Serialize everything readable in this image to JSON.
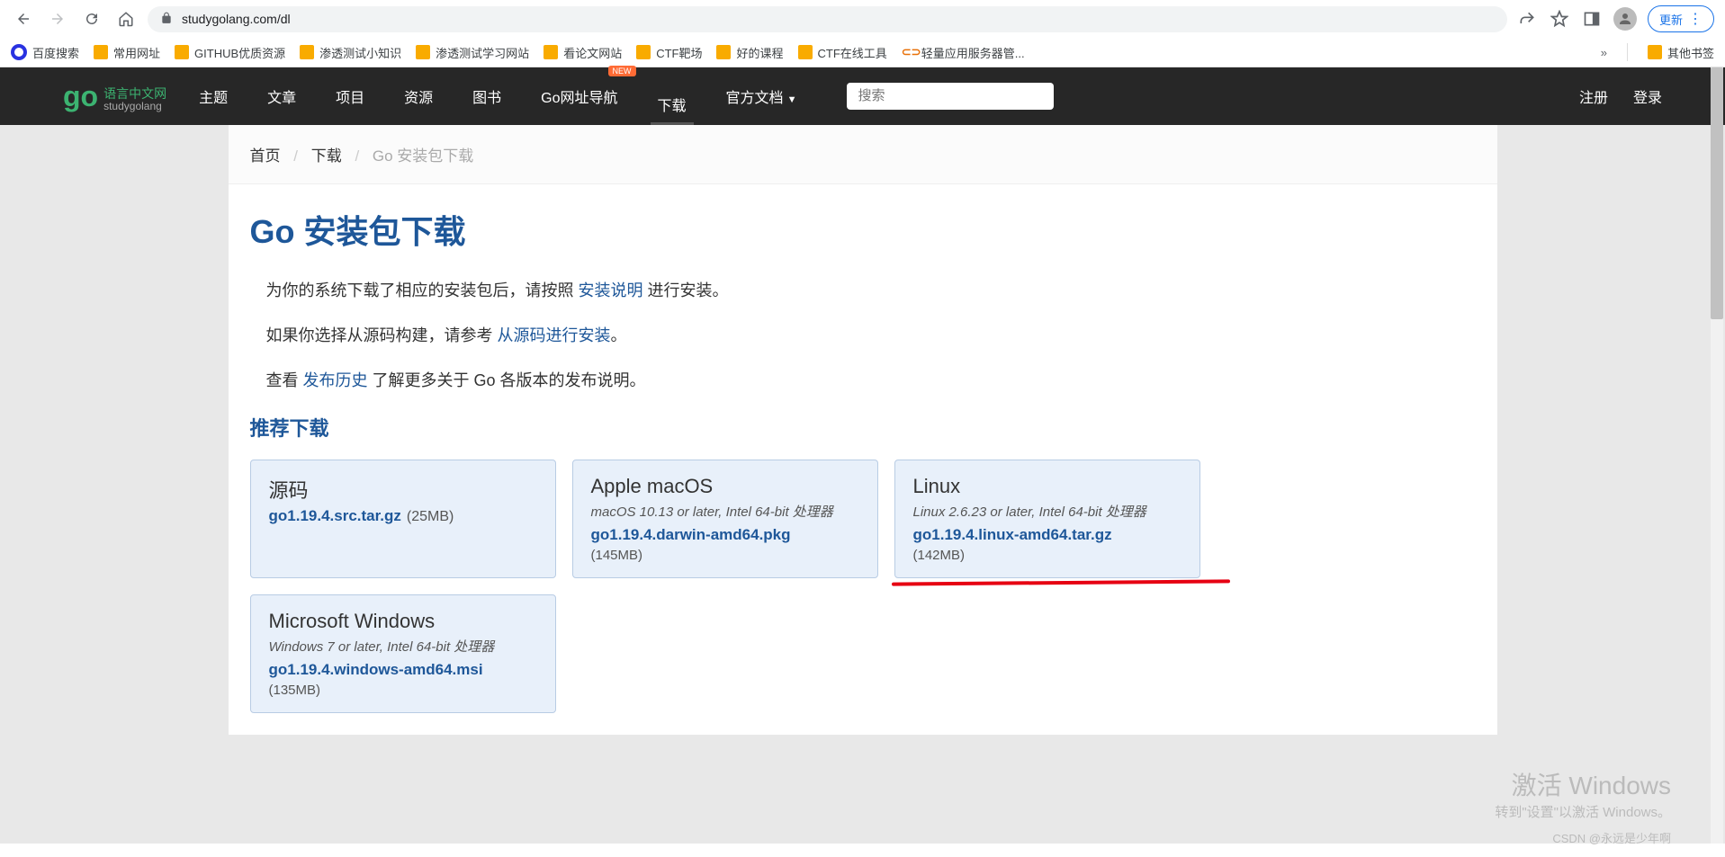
{
  "browser": {
    "url_display": "studygolang.com/dl",
    "update_label": "更新",
    "bookmarks": [
      {
        "icon": "baidu",
        "label": "百度搜索"
      },
      {
        "icon": "folder",
        "label": "常用网址"
      },
      {
        "icon": "folder",
        "label": "GITHUB优质资源"
      },
      {
        "icon": "folder",
        "label": "渗透测试小知识"
      },
      {
        "icon": "folder",
        "label": "渗透测试学习网站"
      },
      {
        "icon": "folder",
        "label": "看论文网站"
      },
      {
        "icon": "folder",
        "label": "CTF靶场"
      },
      {
        "icon": "folder",
        "label": "好的课程"
      },
      {
        "icon": "folder",
        "label": "CTF在线工具"
      },
      {
        "icon": "link",
        "label": "轻量应用服务器管..."
      }
    ],
    "more": "»",
    "other_bookmarks": "其他书签"
  },
  "nav": {
    "logo_cn": "语言中文网",
    "logo_en": "studygolang",
    "items": [
      "主题",
      "文章",
      "项目",
      "资源",
      "图书"
    ],
    "go_nav": "Go网址导航",
    "new_badge": "NEW",
    "download": "下载",
    "docs": "官方文档",
    "search_placeholder": "搜索",
    "register": "注册",
    "login": "登录"
  },
  "breadcrumb": {
    "home": "首页",
    "download": "下载",
    "current": "Go 安装包下载"
  },
  "page": {
    "title": "Go 安装包下载",
    "para1_a": "为你的系统下载了相应的安装包后，请按照 ",
    "para1_link": "安装说明",
    "para1_b": " 进行安装。",
    "para2_a": "如果你选择从源码构建，请参考 ",
    "para2_link": "从源码进行安装",
    "para2_b": "。",
    "para3_a": "查看 ",
    "para3_link": "发布历史",
    "para3_b": " 了解更多关于 Go 各版本的发布说明。",
    "section_title": "推荐下载"
  },
  "downloads": [
    {
      "title": "源码",
      "desc": "",
      "file": "go1.19.4.src.tar.gz",
      "size": "(25MB)",
      "inline_size": true,
      "highlight": false
    },
    {
      "title": "Apple macOS",
      "desc": "macOS 10.13 or later, Intel 64-bit 处理器",
      "file": "go1.19.4.darwin-amd64.pkg",
      "size": "(145MB)",
      "inline_size": false,
      "highlight": false
    },
    {
      "title": "Linux",
      "desc": "Linux 2.6.23 or later, Intel 64-bit 处理器",
      "file": "go1.19.4.linux-amd64.tar.gz",
      "size": "(142MB)",
      "inline_size": false,
      "highlight": true
    },
    {
      "title": "Microsoft Windows",
      "desc": "Windows 7 or later, Intel 64-bit 处理器",
      "file": "go1.19.4.windows-amd64.msi",
      "size": "(135MB)",
      "inline_size": false,
      "highlight": false
    }
  ],
  "watermark": {
    "line1": "激活 Windows",
    "line2": "转到\"设置\"以激活 Windows。"
  },
  "csdn": "CSDN @永远是少年啊"
}
